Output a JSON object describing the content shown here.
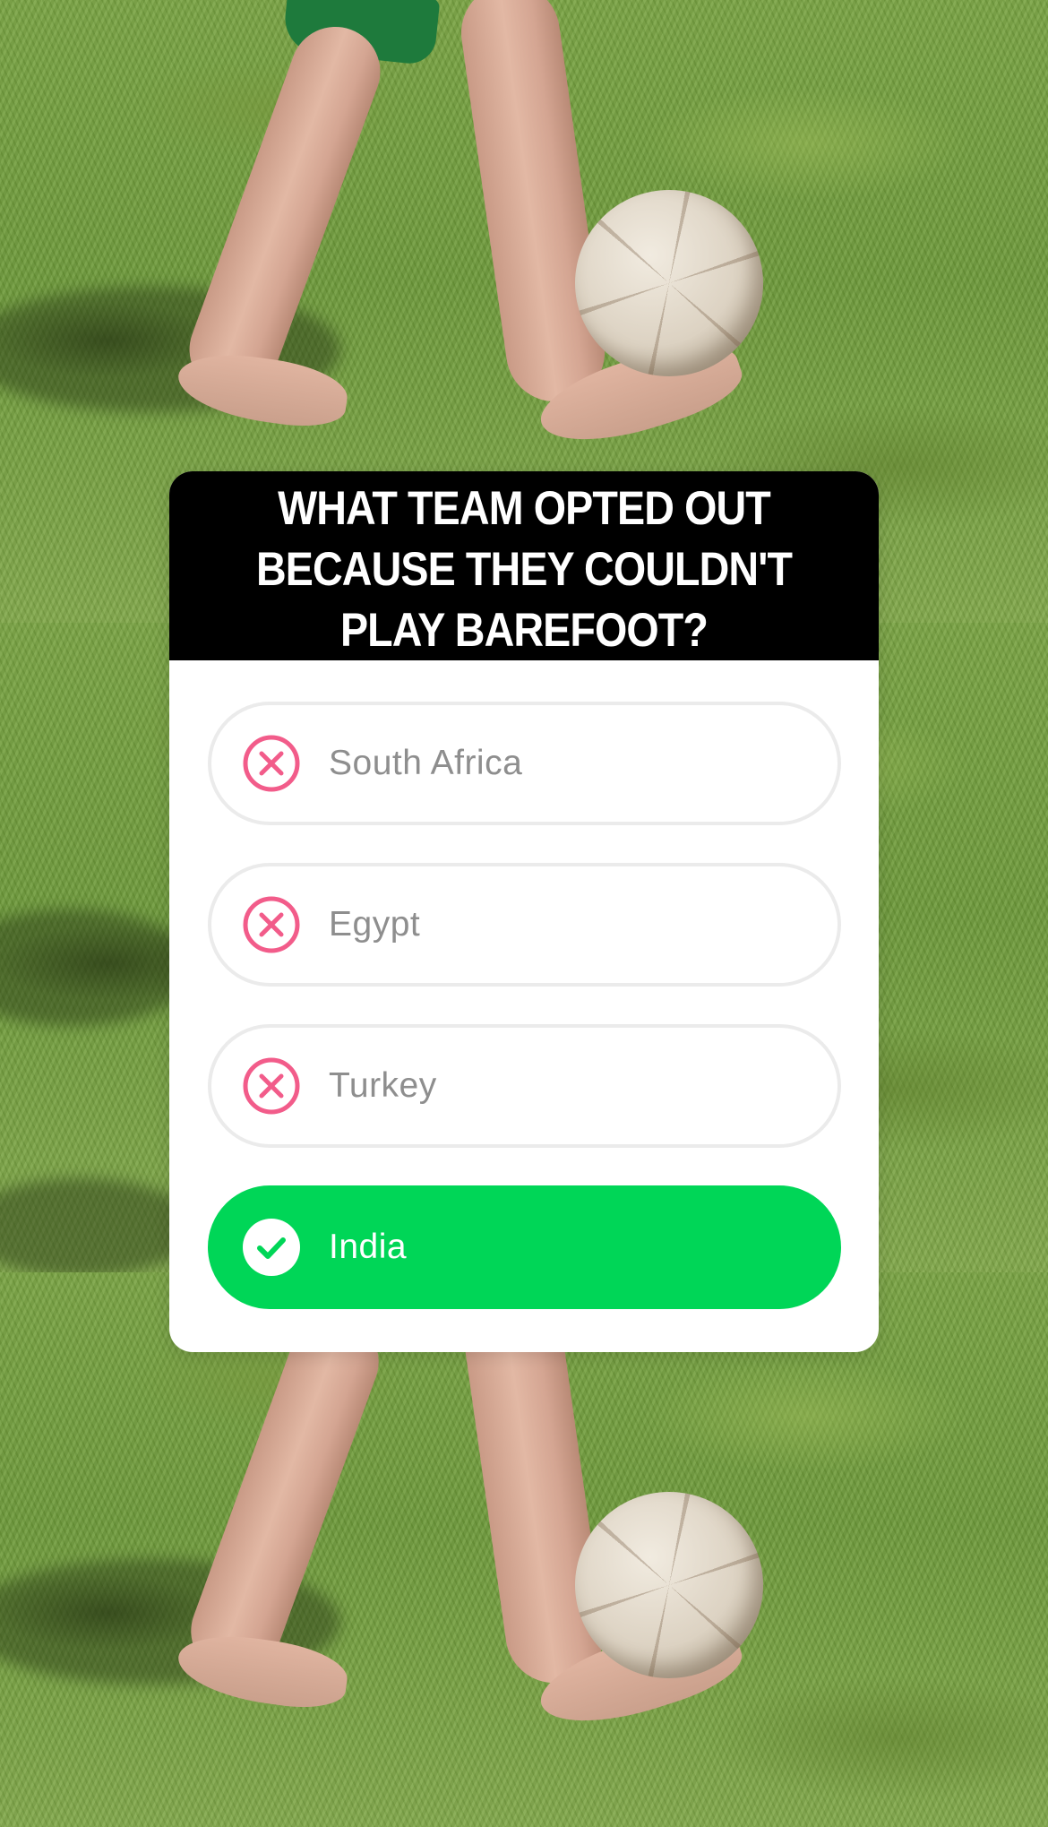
{
  "quiz": {
    "question": "WHAT TEAM OPTED OUT BECAUSE THEY COULDN'T PLAY BAREFOOT?",
    "options": [
      {
        "label": "South Africa",
        "state": "incorrect",
        "icon": "x-circle-icon"
      },
      {
        "label": "Egypt",
        "state": "incorrect",
        "icon": "x-circle-icon"
      },
      {
        "label": "Turkey",
        "state": "incorrect",
        "icon": "x-circle-icon"
      },
      {
        "label": "India",
        "state": "correct",
        "icon": "check-circle-icon"
      }
    ]
  },
  "colors": {
    "header_bg": "#000000",
    "card_bg": "#ffffff",
    "correct_green": "#00d657",
    "incorrect_pink": "#f25c8a",
    "option_text": "#8e8e8e",
    "option_border": "#ebebeb"
  }
}
